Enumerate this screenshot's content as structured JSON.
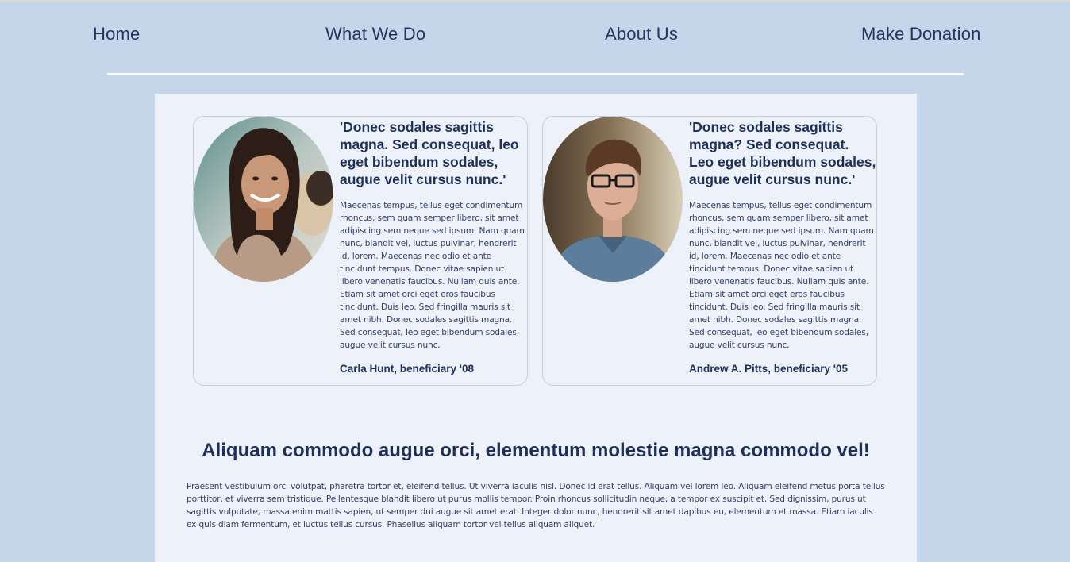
{
  "nav": {
    "items": [
      "Home",
      "What We Do",
      "About Us",
      "Make Donation"
    ]
  },
  "testimonials": [
    {
      "quote": "'Donec sodales sagittis magna. Sed consequat, leo eget bibendum sodales, augue velit cursus nunc.'",
      "body": "Maecenas tempus, tellus eget condimentum rhoncus, sem quam semper libero, sit amet adipiscing sem neque sed ipsum. Nam quam nunc, blandit vel, luctus pulvinar, hendrerit id, lorem. Maecenas nec odio et ante tincidunt tempus. Donec vitae sapien ut libero venenatis faucibus. Nullam quis ante. Etiam sit amet orci eget eros faucibus tincidunt. Duis leo. Sed fringilla mauris sit amet nibh. Donec sodales sagittis magna. Sed consequat, leo eget bibendum sodales, augue velit cursus nunc,",
      "attribution": "Carla Hunt, beneficiary '08"
    },
    {
      "quote": "'Donec sodales sagittis magna? Sed consequat. Leo eget bibendum sodales, augue velit cursus nunc.'",
      "body": "Maecenas tempus, tellus eget condimentum rhoncus, sem quam semper libero, sit amet adipiscing sem neque sed ipsum. Nam quam nunc, blandit vel, luctus pulvinar, hendrerit id, lorem. Maecenas nec odio et ante tincidunt tempus. Donec vitae sapien ut libero venenatis faucibus. Nullam quis ante. Etiam sit amet orci eget eros faucibus tincidunt. Duis leo. Sed fringilla mauris sit amet nibh. Donec sodales sagittis magna. Sed consequat, leo eget bibendum sodales, augue velit cursus nunc,",
      "attribution": "Andrew A. Pitts, beneficiary '05"
    }
  ],
  "section": {
    "headline": "Aliquam commodo augue orci, elementum molestie magna commodo vel!",
    "paragraph": "Praesent vestibulum orci volutpat, pharetra tortor et, eleifend tellus. Ut viverra iaculis nisl. Donec id erat tellus. Aliquam vel lorem leo. Aliquam eleifend metus porta tellus porttitor, et viverra sem tristique. Pellentesque blandit libero ut purus mollis tempor. Proin rhoncus sollicitudin neque, a tempor ex suscipit et. Sed dignissim, purus ut sagittis vulputate, massa enim mattis sapien, ut semper dui augue sit amet erat. Integer dolor nunc, hendrerit sit amet dapibus eu, elementum et massa. Etiam iaculis ex quis diam fermentum, et luctus tellus cursus. Phasellus aliquam tortor vel tellus aliquam aliquet."
  },
  "colors": {
    "page_background": "#c5d5ea",
    "content_background": "#edf1fa",
    "heading_text": "#1f2f5c",
    "body_text": "#34406b",
    "nav_underline": "#ffffff"
  }
}
